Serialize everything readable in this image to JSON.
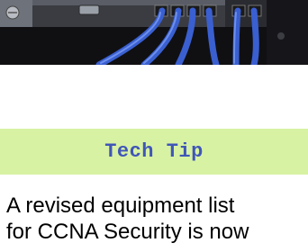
{
  "photo": {
    "icon": "network-switch-cables-photo"
  },
  "tech_tip": {
    "title": "Tech Tip",
    "background_color": "#d8f2a4",
    "title_color": "#3f56b8"
  },
  "article": {
    "line1": "A revised equipment list",
    "line2": "for CCNA Security is now"
  }
}
